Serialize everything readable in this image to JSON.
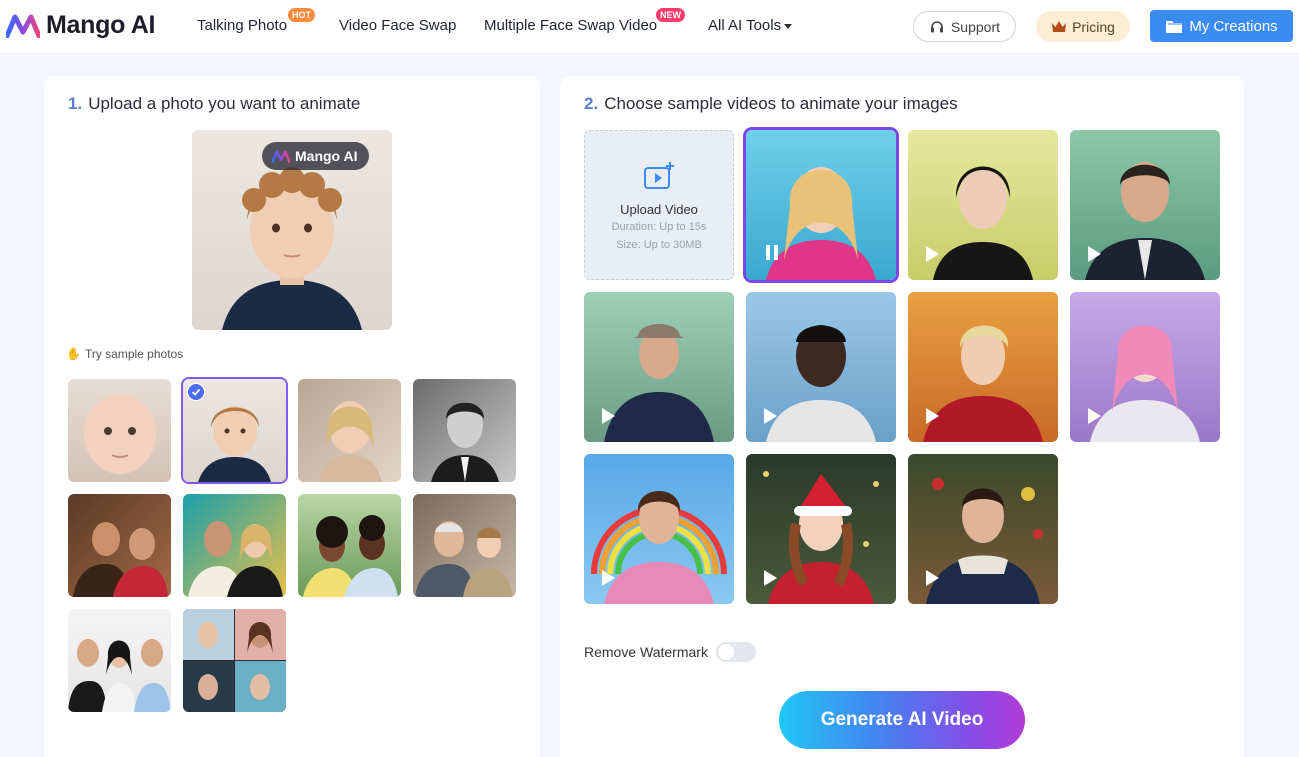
{
  "header": {
    "logo_text": "Mango AI",
    "nav": [
      {
        "label": "Talking Photo",
        "badge": "HOT"
      },
      {
        "label": "Video Face Swap",
        "badge": ""
      },
      {
        "label": "Multiple Face Swap Video",
        "badge": "NEW"
      },
      {
        "label": "All AI Tools",
        "badge": ""
      }
    ],
    "support_label": "Support",
    "pricing_label": "Pricing",
    "creations_label": "My Creations"
  },
  "left_panel": {
    "step_num": "1.",
    "title": "Upload a photo you want to animate",
    "watermark_text": "Mango AI",
    "try_label": "Try sample photos",
    "samples_count_selected_index": 1
  },
  "right_panel": {
    "step_num": "2.",
    "title": "Choose sample videos to animate your images",
    "upload_title": "Upload Video",
    "upload_duration": "Duration: Up to 15s",
    "upload_size": "Size: Up to 30MB",
    "remove_watermark_label": "Remove Watermark",
    "remove_watermark_on": false,
    "generate_label": "Generate AI Video",
    "selected_video_index": 0
  },
  "colors": {
    "accent": "#3a8bf2",
    "selection": "#7a48e8",
    "hot_badge": "#ff8a3c",
    "new_badge": "#ff3b6b"
  }
}
